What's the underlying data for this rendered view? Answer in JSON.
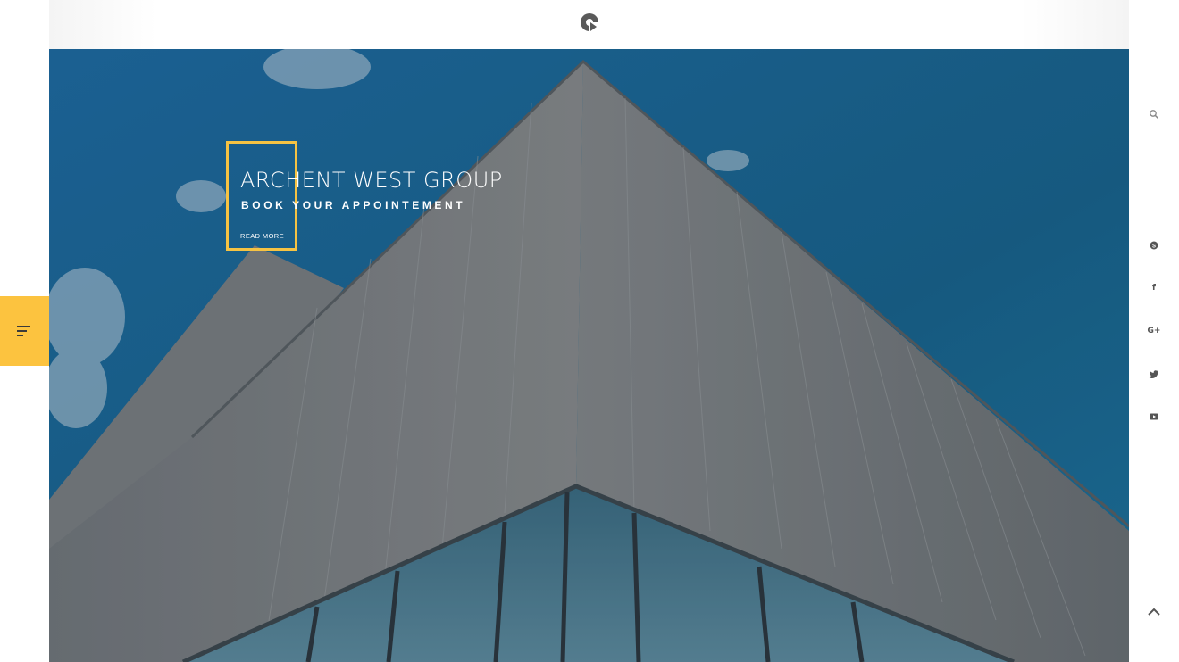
{
  "header": {
    "logo_icon": "play-logo-icon"
  },
  "hero": {
    "title": "ARCHENT WEST GROUP",
    "subtitle": "BOOK YOUR APPOINTEMENT",
    "read_more": "READ MORE",
    "accent_color": "#f6c343"
  },
  "menu_tab": {
    "icon": "menu-lines-icon",
    "color": "#fcc33f"
  },
  "sidebar": {
    "icons": [
      "search-icon",
      "skype-icon",
      "facebook-icon",
      "google-plus-icon",
      "twitter-icon",
      "youtube-icon"
    ],
    "google_plus_label": "G+",
    "facebook_label": "f",
    "scroll_top_icon": "chevron-up-icon"
  }
}
